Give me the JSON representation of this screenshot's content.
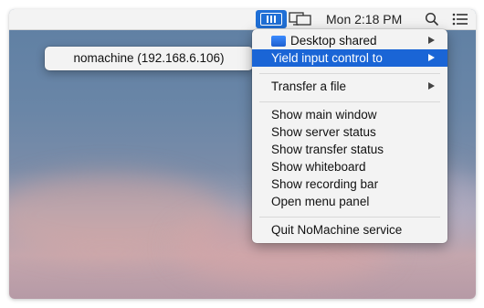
{
  "menubar": {
    "app_icon": "nomachine-icon",
    "display_icon": "display-sharing-icon",
    "clock": "Mon 2:18 PM",
    "search_icon": "search-icon",
    "list_icon": "notification-list-icon"
  },
  "submenu": {
    "item": "nomachine (192.168.6.106)"
  },
  "menu": {
    "desktop_shared": "Desktop shared",
    "yield_input": "Yield input control to",
    "transfer_file": "Transfer a file",
    "show_main_window": "Show main window",
    "show_server_status": "Show server status",
    "show_transfer_status": "Show transfer status",
    "show_whiteboard": "Show whiteboard",
    "show_recording_bar": "Show recording bar",
    "open_menu_panel": "Open menu panel",
    "quit": "Quit NoMachine service"
  },
  "colors": {
    "selection": "#1a65d6",
    "app_icon_bg": "#1f6fd6"
  }
}
